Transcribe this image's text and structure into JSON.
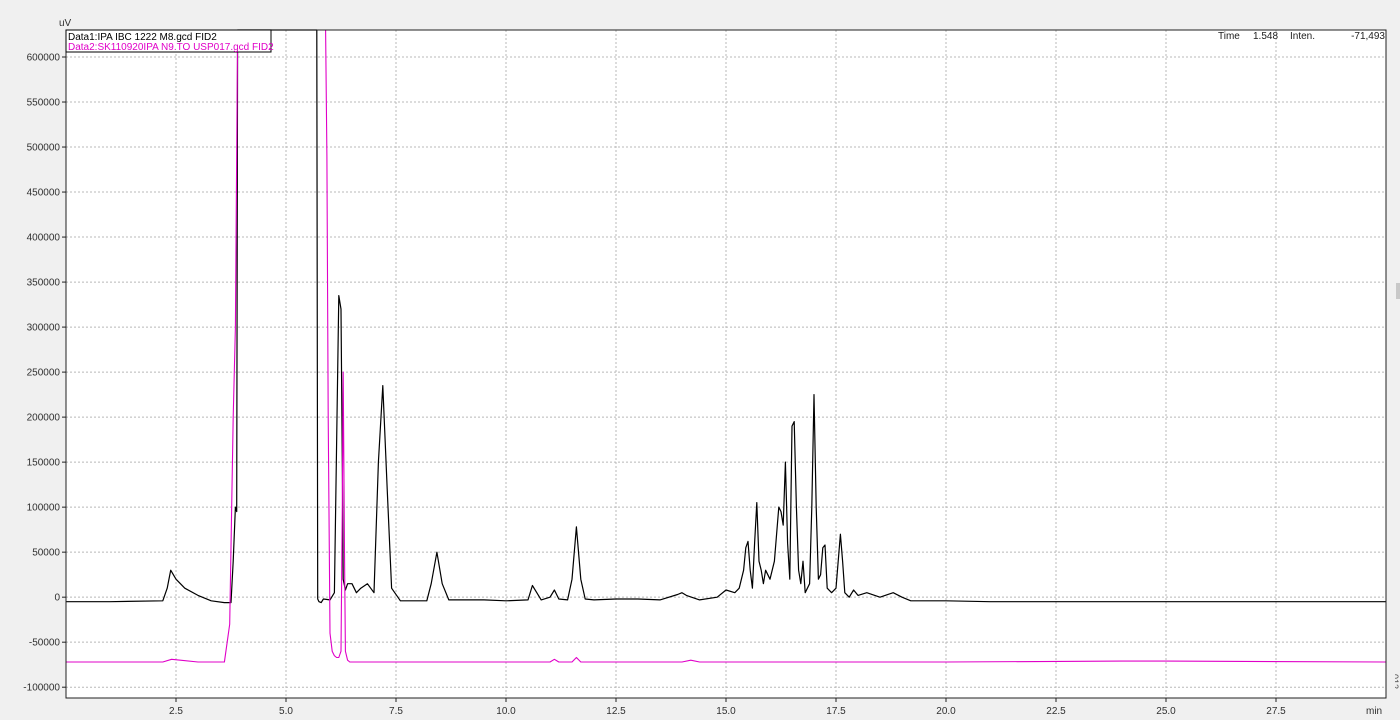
{
  "chart_data": {
    "type": "line",
    "y_unit": "uV",
    "x_unit": "min",
    "xlim": [
      0,
      30
    ],
    "ylim": [
      -112000,
      630000
    ],
    "x_ticks": [
      2.5,
      5.0,
      7.5,
      10.0,
      12.5,
      15.0,
      17.5,
      20.0,
      22.5,
      25.0,
      27.5
    ],
    "x_tick_labels": [
      "2.5",
      "5.0",
      "7.5",
      "10.0",
      "12.5",
      "15.0",
      "17.5",
      "20.0",
      "22.5",
      "25.0",
      "27.5"
    ],
    "y_ticks": [
      600000,
      550000,
      500000,
      450000,
      400000,
      350000,
      300000,
      250000,
      200000,
      150000,
      100000,
      50000,
      0,
      -50000,
      -100000
    ],
    "y_tick_labels": [
      "600000",
      "550000",
      "500000",
      "450000",
      "400000",
      "350000",
      "300000",
      "250000",
      "200000",
      "150000",
      "100000",
      "50000",
      "0",
      "-50000",
      "-100000"
    ],
    "grid": true,
    "legend_position": "top-left",
    "series": [
      {
        "name": "Data1:IPA IBC 1222 M8.gcd FID2",
        "color": "#000000",
        "x": [
          0.0,
          1.0,
          2.2,
          2.3,
          2.38,
          2.5,
          2.7,
          3.0,
          3.3,
          3.6,
          3.75,
          3.8,
          3.85,
          3.88,
          3.9,
          3.93,
          3.95,
          4.0,
          4.05,
          5.2,
          5.7,
          5.72,
          5.75,
          5.8,
          5.85,
          6.0,
          6.1,
          6.2,
          6.25,
          6.28,
          6.3,
          6.35,
          6.4,
          6.5,
          6.6,
          6.7,
          6.85,
          7.0,
          7.1,
          7.2,
          7.3,
          7.4,
          7.6,
          8.2,
          8.3,
          8.43,
          8.55,
          8.7,
          9.5,
          10.0,
          10.5,
          10.6,
          10.7,
          10.8,
          11.0,
          11.1,
          11.2,
          11.4,
          11.5,
          11.6,
          11.7,
          11.8,
          12.0,
          12.5,
          13.0,
          13.5,
          13.9,
          14.0,
          14.1,
          14.4,
          14.8,
          15.0,
          15.2,
          15.3,
          15.4,
          15.45,
          15.5,
          15.55,
          15.6,
          15.65,
          15.7,
          15.75,
          15.8,
          15.85,
          15.9,
          16.0,
          16.1,
          16.2,
          16.25,
          16.3,
          16.35,
          16.4,
          16.45,
          16.5,
          16.55,
          16.6,
          16.65,
          16.7,
          16.75,
          16.8,
          16.9,
          16.95,
          17.0,
          17.05,
          17.1,
          17.15,
          17.2,
          17.25,
          17.3,
          17.4,
          17.5,
          17.6,
          17.65,
          17.7,
          17.8,
          17.9,
          18.0,
          18.2,
          18.5,
          18.8,
          19.0,
          19.2,
          19.5,
          20.0,
          21.0,
          30.0
        ],
        "y": [
          -5000,
          -5000,
          -4000,
          10000,
          30000,
          20000,
          10000,
          2000,
          -4000,
          -6000,
          -6000,
          40000,
          100000,
          95000,
          630000,
          630000,
          630000,
          630000,
          630000,
          630000,
          630000,
          -2000,
          -5000,
          -6000,
          -2000,
          -3000,
          5000,
          335000,
          320000,
          150000,
          20000,
          8000,
          15000,
          15000,
          5000,
          10000,
          15000,
          5000,
          150000,
          235000,
          120000,
          10000,
          -4000,
          -4000,
          15000,
          50000,
          15000,
          -3000,
          -3000,
          -4000,
          -3000,
          13000,
          5000,
          -3000,
          0,
          8000,
          -2000,
          -3000,
          20000,
          78000,
          20000,
          -2000,
          -3000,
          -2000,
          -2000,
          -3000,
          3000,
          5000,
          2000,
          -3000,
          0,
          8000,
          5000,
          10000,
          30000,
          55000,
          62000,
          30000,
          10000,
          60000,
          105000,
          40000,
          30000,
          15000,
          30000,
          20000,
          40000,
          100000,
          95000,
          80000,
          150000,
          60000,
          20000,
          190000,
          195000,
          100000,
          30000,
          15000,
          40000,
          5000,
          15000,
          100000,
          225000,
          100000,
          20000,
          25000,
          55000,
          58000,
          10000,
          5000,
          10000,
          70000,
          40000,
          5000,
          0,
          8000,
          2000,
          5000,
          0,
          5000,
          0,
          -4000,
          -4000,
          -4000,
          -5000,
          -5000
        ]
      },
      {
        "name": "Data2:SK110920IPA N9.TO USP017.gcd FID2",
        "color": "#e000c8",
        "x": [
          0.0,
          1.5,
          2.2,
          2.4,
          2.6,
          3.0,
          3.6,
          3.72,
          3.8,
          3.85,
          3.9,
          3.93,
          4.0,
          4.05,
          5.9,
          5.93,
          5.96,
          6.0,
          6.05,
          6.1,
          6.15,
          6.2,
          6.25,
          6.28,
          6.3,
          6.33,
          6.35,
          6.4,
          6.45,
          6.5,
          10.0,
          11.0,
          11.1,
          11.2,
          11.5,
          11.6,
          11.7,
          14.0,
          14.2,
          14.4,
          20.0,
          24.0,
          25.0,
          30.0
        ],
        "y": [
          -72000,
          -72000,
          -72000,
          -69000,
          -70000,
          -72000,
          -72000,
          -30000,
          200000,
          300000,
          630000,
          630000,
          630000,
          630000,
          630000,
          490000,
          200000,
          -40000,
          -60000,
          -65000,
          -67000,
          -67000,
          -60000,
          100000,
          250000,
          50000,
          -60000,
          -70000,
          -72000,
          -72000,
          -72000,
          -72000,
          -69000,
          -72000,
          -72000,
          -67000,
          -72000,
          -72000,
          -70000,
          -72000,
          -72000,
          -71000,
          -71000,
          -72000
        ]
      }
    ]
  },
  "legend": {
    "entries": [
      "Data1:IPA IBC 1222 M8.gcd FID2",
      "Data2:SK110920IPA N9.TO USP017.gcd FID2"
    ]
  },
  "readout": {
    "time_label": "Time",
    "time_value": "1.548",
    "inten_label": "Inten.",
    "inten_value": "-71,493"
  },
  "corner_label": "012"
}
